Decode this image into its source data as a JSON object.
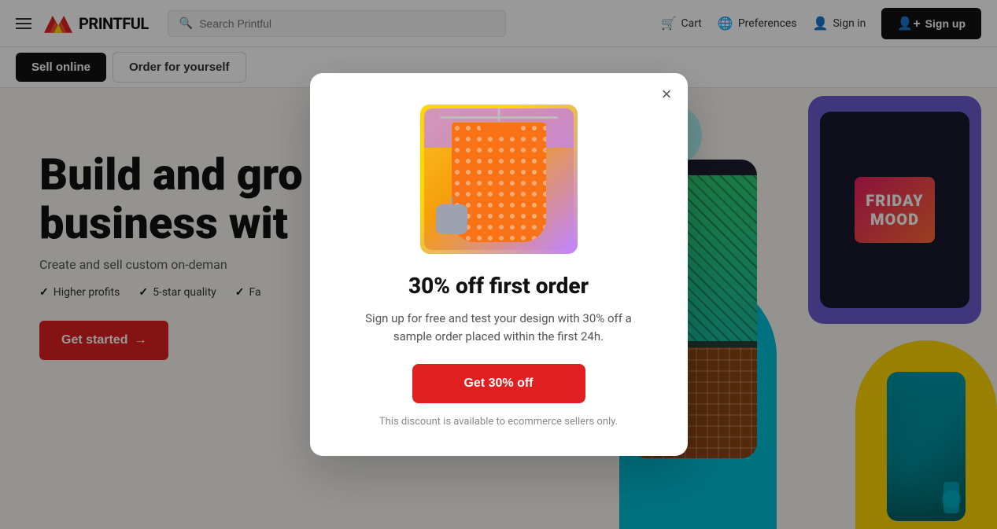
{
  "navbar": {
    "menu_icon_label": "Menu",
    "logo_text": "PRINTFUL",
    "search_placeholder": "Search Printful",
    "cart_label": "Cart",
    "preferences_label": "Preferences",
    "signin_label": "Sign in",
    "signup_label": "Sign up"
  },
  "subnav": {
    "sell_online": "Sell online",
    "order_for_yourself": "Order for yourself"
  },
  "hero": {
    "title_line1": "Build and gro",
    "title_line2": "business wit",
    "subtitle": "Create and sell custom on-deman",
    "check1": "Higher profits",
    "check2": "5-star quality",
    "check3": "Fa",
    "cta_label": "Get started"
  },
  "modal": {
    "close_label": "×",
    "title": "30% off first order",
    "description": "Sign up for free and test your design with 30% off a sample order placed within the first 24h.",
    "cta_label": "Get 30% off",
    "fine_print": "This discount is available to ecommerce sellers only."
  },
  "colors": {
    "brand_red": "#e02020",
    "brand_dark": "#111111",
    "nav_border": "#e5e5e5"
  }
}
